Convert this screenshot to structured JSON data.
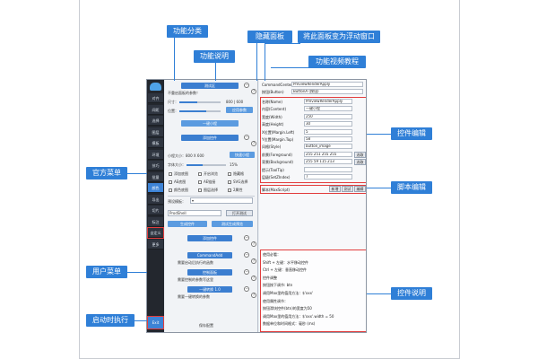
{
  "annotations": {
    "category": "功能分类",
    "description": "功能说明",
    "hide_panel": "隐藏面板",
    "float_window": "将此面板变为浮动窗口",
    "video_tutorial": "功能视频教程",
    "official_menu": "官方菜单",
    "control_edit": "控件编辑",
    "script_edit": "脚本编辑",
    "user_menu": "用户菜单",
    "control_help": "控件说明",
    "startup_exec": "启动时执行"
  },
  "sidebar": {
    "items": [
      "对齐",
      "间距",
      "选择",
      "图层",
      "模板",
      "环境",
      "技巧",
      "批量",
      "颜色",
      "导出",
      "切片",
      "标注",
      "自定义",
      "更多"
    ],
    "active_index": 8,
    "user_item": "自定义",
    "exit_label": "Exit"
  },
  "mid": {
    "section1_btn": "测试区",
    "section1_desc": "不重启面板的参数！",
    "row_label": "尺寸：",
    "row_values": "800 | 600",
    "btn_apply": "应用参数",
    "btn_oneclick": "一键小程",
    "btn_add_control": "添加控件",
    "size_label": "小程大小：800 X 600",
    "btn_fast": "快速小程",
    "font_label": "字体大小：",
    "font_value": "15%",
    "checks_row1": [
      "添加底图",
      "开启浏览",
      "隐藏格"
    ],
    "checks_row2": [
      "AE底图",
      "AE链接",
      "SVG选择"
    ],
    "checks_row3": [
      "颜色底图",
      "图层选择",
      "2属性"
    ],
    "select_label": "预设模板：",
    "input_value": "ProdShell",
    "btn_run": "打开测试",
    "btn_export": "生成控件",
    "btn_export2": "测试生成预览",
    "sub_sections": [
      {
        "btn": "添加控件",
        "desc": ""
      },
      {
        "btn": "CommandAdd",
        "desc": "需要启动后执行的函数"
      },
      {
        "btn": "控制面板",
        "desc": "需要控制的参数写这里"
      },
      {
        "btn": "一键转换 1.0",
        "desc": "需要一键转换的参数"
      }
    ],
    "footer": "保存配置"
  },
  "right": {
    "top1": "CommandCenter",
    "top2": "PreviewRenderApply",
    "top3": "按钮(Button)",
    "top3_val": "ButtonA (按钮)",
    "fields": [
      {
        "label": "名称(Name)",
        "value": "PreviewRenderApply"
      },
      {
        "label": "内容(Content)",
        "value": "一键小程"
      },
      {
        "label": "宽度(Width)",
        "value": "250"
      },
      {
        "label": "高度(Height)",
        "value": "30"
      },
      {
        "label": "X位置(Margin.Left)",
        "value": "5"
      },
      {
        "label": "Y位置(Margin.Top)",
        "value": "58"
      },
      {
        "label": "风格(Style)",
        "value": "button_image"
      },
      {
        "label": "前景(Foreground)",
        "value": "255 251 255 255"
      },
      {
        "label": "背景(Background)",
        "value": "255 59 115 213"
      },
      {
        "label": "提示(ToolTip)",
        "value": ""
      },
      {
        "label": "层级(SetZIndex)",
        "value": "7"
      }
    ],
    "color_btn": "选取",
    "script_label": "脚本(MaxScript)",
    "script_btns": [
      "新增",
      "测试",
      "编辑"
    ],
    "help_lines": [
      "使用必看：",
      "Shift + 左键：水平移动控件",
      "Ctrl + 左键：垂直移动控件",
      "控件调整",
      "按钮按下调节: btn",
      "调用Max里的值用方法：$'xxx'",
      "使用属性调节：",
      "按钮滑块控件(btn)的宽度为50",
      "调用Max里的值用方法：$'xxx'.width = 50",
      "数据单位和时间格式：毫秒 (ms)"
    ]
  },
  "colors": {
    "accent": "#2f7fd7",
    "annotation_red": "#e23d3d",
    "sidebar_bg": "#23272e"
  }
}
